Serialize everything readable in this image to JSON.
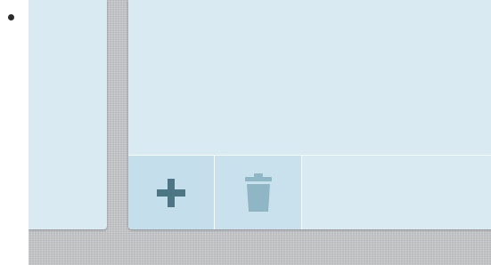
{
  "toolbar": {
    "buttons": [
      {
        "icon": "plus-icon",
        "color": "#4c7684"
      },
      {
        "icon": "trash-icon",
        "color": "#8fb6c5"
      }
    ]
  },
  "colors": {
    "panel_bg": "#d9eaf3",
    "active_button_bg": "#c4dfeb",
    "background_linen": "#c3c5c8"
  }
}
